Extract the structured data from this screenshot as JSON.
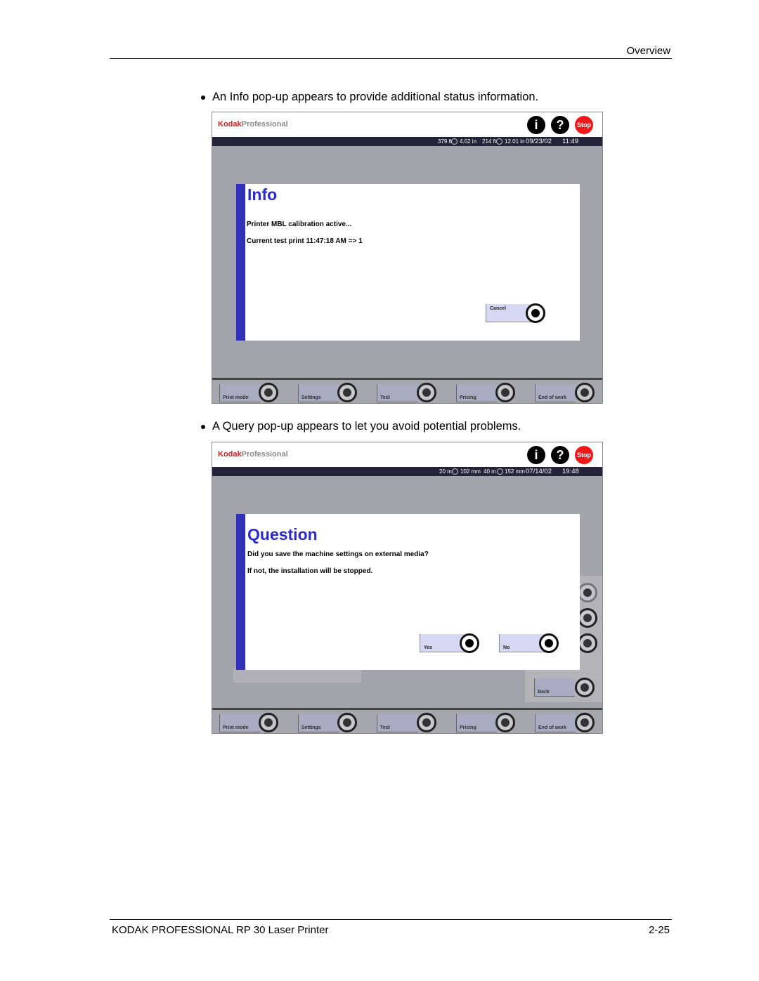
{
  "page": {
    "header": "Overview",
    "footer_left": "KODAK PROFESSIONAL RP 30 Laser Printer",
    "footer_right": "2-25"
  },
  "bullets": [
    "An Info pop-up appears to provide additional status information.",
    "A Query pop-up appears to let you avoid potential problems."
  ],
  "common": {
    "logo_kodak": "Kodak",
    "logo_professional": "Professional",
    "info_icon": "i",
    "help_icon": "?",
    "stop_label": "Stop",
    "bottom_buttons": [
      "Print mode",
      "Settings",
      "Test",
      "Pricing",
      "End of work"
    ]
  },
  "screen1": {
    "status": {
      "roll1_len": "379 ft",
      "roll1_width": "4.02 in",
      "roll2_len": "214 ft",
      "roll2_width": "12.01 in",
      "date": "09/23/02",
      "time": "11:49"
    },
    "popup": {
      "title": "Info",
      "lines": [
        "Printer MBL calibration active...",
        "Current test print 11:47:18 AM => 1"
      ],
      "cancel_label": "Cancel"
    }
  },
  "screen2": {
    "status": {
      "roll1_len": "20 m",
      "roll1_width": "102 mm",
      "roll2_len": "40 m",
      "roll2_width": "152 mm",
      "date": "07/14/02",
      "time": "19:48"
    },
    "popup": {
      "title": "Question",
      "lines": [
        "Did you save the machine settings on external media?",
        "If not, the installation will be stopped."
      ],
      "yes_label": "Yes",
      "no_label": "No"
    },
    "back_label": "Back"
  }
}
